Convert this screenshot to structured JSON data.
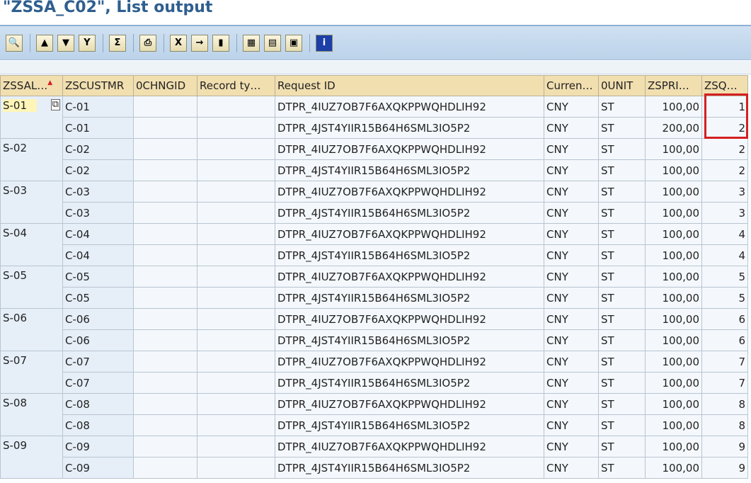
{
  "title": "\"ZSSA_C02\", List output",
  "toolbar": [
    {
      "icon": "details-icon",
      "glyph": "🔍"
    },
    "sep",
    {
      "icon": "sort-ascending-icon",
      "glyph": "▲"
    },
    {
      "icon": "sort-descending-icon",
      "glyph": "▼"
    },
    {
      "icon": "filter-icon",
      "glyph": "Y"
    },
    "sep",
    {
      "icon": "sum-icon",
      "glyph": "Σ"
    },
    "sep",
    {
      "icon": "print-preview-icon",
      "glyph": "⎙"
    },
    "sep",
    {
      "icon": "excel-icon",
      "glyph": "X"
    },
    {
      "icon": "export-icon",
      "glyph": "→"
    },
    {
      "icon": "graphic-icon",
      "glyph": "▮"
    },
    "sep",
    {
      "icon": "change-layout-icon",
      "glyph": "▦"
    },
    {
      "icon": "select-layout-icon",
      "glyph": "▤"
    },
    {
      "icon": "save-layout-icon",
      "glyph": "▣"
    },
    "sep",
    {
      "icon": "information-icon",
      "glyph": "i"
    }
  ],
  "columns": [
    "ZSSAL…",
    "ZSCUSTMR",
    "0CHNGID",
    "Record ty…",
    "Request ID",
    "Curren…",
    "0UNIT",
    "ZSPRI…",
    "ZSQ…"
  ],
  "groups": [
    {
      "sal": "S-01",
      "rows": [
        [
          "C-01",
          "",
          "",
          "DTPR_4IUZ7OB7F6AXQKPPWQHDLIH92",
          "CNY",
          "ST",
          "100,00",
          "1"
        ],
        [
          "C-01",
          "",
          "",
          "DTPR_4JST4YIIR15B64H6SML3IO5P2",
          "CNY",
          "ST",
          "200,00",
          "2"
        ]
      ]
    },
    {
      "sal": "S-02",
      "rows": [
        [
          "C-02",
          "",
          "",
          "DTPR_4IUZ7OB7F6AXQKPPWQHDLIH92",
          "CNY",
          "ST",
          "100,00",
          "2"
        ],
        [
          "C-02",
          "",
          "",
          "DTPR_4JST4YIIR15B64H6SML3IO5P2",
          "CNY",
          "ST",
          "100,00",
          "2"
        ]
      ]
    },
    {
      "sal": "S-03",
      "rows": [
        [
          "C-03",
          "",
          "",
          "DTPR_4IUZ7OB7F6AXQKPPWQHDLIH92",
          "CNY",
          "ST",
          "100,00",
          "3"
        ],
        [
          "C-03",
          "",
          "",
          "DTPR_4JST4YIIR15B64H6SML3IO5P2",
          "CNY",
          "ST",
          "100,00",
          "3"
        ]
      ]
    },
    {
      "sal": "S-04",
      "rows": [
        [
          "C-04",
          "",
          "",
          "DTPR_4IUZ7OB7F6AXQKPPWQHDLIH92",
          "CNY",
          "ST",
          "100,00",
          "4"
        ],
        [
          "C-04",
          "",
          "",
          "DTPR_4JST4YIIR15B64H6SML3IO5P2",
          "CNY",
          "ST",
          "100,00",
          "4"
        ]
      ]
    },
    {
      "sal": "S-05",
      "rows": [
        [
          "C-05",
          "",
          "",
          "DTPR_4IUZ7OB7F6AXQKPPWQHDLIH92",
          "CNY",
          "ST",
          "100,00",
          "5"
        ],
        [
          "C-05",
          "",
          "",
          "DTPR_4JST4YIIR15B64H6SML3IO5P2",
          "CNY",
          "ST",
          "100,00",
          "5"
        ]
      ]
    },
    {
      "sal": "S-06",
      "rows": [
        [
          "C-06",
          "",
          "",
          "DTPR_4IUZ7OB7F6AXQKPPWQHDLIH92",
          "CNY",
          "ST",
          "100,00",
          "6"
        ],
        [
          "C-06",
          "",
          "",
          "DTPR_4JST4YIIR15B64H6SML3IO5P2",
          "CNY",
          "ST",
          "100,00",
          "6"
        ]
      ]
    },
    {
      "sal": "S-07",
      "rows": [
        [
          "C-07",
          "",
          "",
          "DTPR_4IUZ7OB7F6AXQKPPWQHDLIH92",
          "CNY",
          "ST",
          "100,00",
          "7"
        ],
        [
          "C-07",
          "",
          "",
          "DTPR_4JST4YIIR15B64H6SML3IO5P2",
          "CNY",
          "ST",
          "100,00",
          "7"
        ]
      ]
    },
    {
      "sal": "S-08",
      "rows": [
        [
          "C-08",
          "",
          "",
          "DTPR_4IUZ7OB7F6AXQKPPWQHDLIH92",
          "CNY",
          "ST",
          "100,00",
          "8"
        ],
        [
          "C-08",
          "",
          "",
          "DTPR_4JST4YIIR15B64H6SML3IO5P2",
          "CNY",
          "ST",
          "100,00",
          "8"
        ]
      ]
    },
    {
      "sal": "S-09",
      "rows": [
        [
          "C-09",
          "",
          "",
          "DTPR_4IUZ7OB7F6AXQKPPWQHDLIH92",
          "CNY",
          "ST",
          "100,00",
          "9"
        ],
        [
          "C-09",
          "",
          "",
          "DTPR_4JST4YIIR15B64H6SML3IO5P2",
          "CNY",
          "ST",
          "100,00",
          "9"
        ]
      ]
    }
  ],
  "highlight_color": "#d42020"
}
